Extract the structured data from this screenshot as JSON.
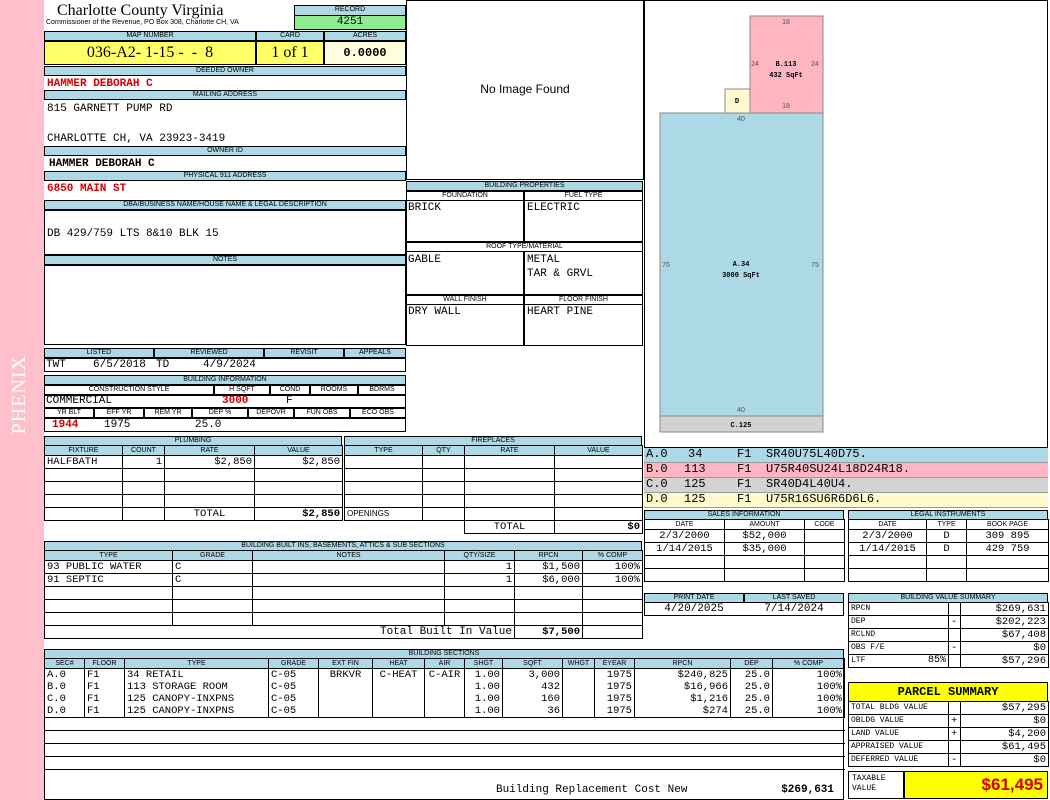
{
  "side_label": "PHENIX",
  "county": {
    "title": "Charlotte County Virginia",
    "subtitle": "Commissioner of the Revenue, PO Box 308, Charlotte CH, VA"
  },
  "record": {
    "label": "RECORD",
    "value": "4251"
  },
  "map_number": {
    "label": "MAP NUMBER",
    "value": "036-A2- 1-15 -  -  8"
  },
  "card": {
    "label": "CARD",
    "value": "1 of 1"
  },
  "acres": {
    "label": "ACRES",
    "value": "0.0000"
  },
  "deeded_owner": {
    "label": "DEEDED OWNER",
    "value": "HAMMER DEBORAH C"
  },
  "mailing_address": {
    "label": "MAILING ADDRESS",
    "line1": "815 GARNETT PUMP RD",
    "line2": "CHARLOTTE CH, VA 23923-3419"
  },
  "owner_id": {
    "label": "OWNER ID",
    "value": "HAMMER DEBORAH C"
  },
  "physical_address": {
    "label": "PHYSICAL 911 ADDRESS",
    "value": "6850 MAIN ST"
  },
  "legal_desc": {
    "label": "DBA/BUSINESS NAME/HOUSE NAME & LEGAL DESCRIPTION",
    "value": "DB 429/759 LTS 8&10 BLK 15"
  },
  "notes": {
    "label": "NOTES"
  },
  "image_placeholder": "No Image Found",
  "building_properties": {
    "label": "BUILDING PROPERTIES",
    "foundation_label": "FOUNDATION",
    "foundation": "BRICK",
    "fuel_label": "FUEL TYPE",
    "fuel": "ELECTRIC",
    "roof_label": "ROOF TYPE/MATERIAL",
    "roof_type": "GABLE",
    "roof_material1": "METAL",
    "roof_material2": "TAR & GRVL",
    "wall_label": "WALL FINISH",
    "wall": "DRY WALL",
    "floor_label": "FLOOR FINISH",
    "floor": "HEART PINE"
  },
  "status": {
    "listed_label": "LISTED",
    "listed_by": "TWT",
    "listed_date": "6/5/2018",
    "reviewed_label": "REVIEWED",
    "reviewed_by": "TD",
    "reviewed_date": "4/9/2024",
    "revisit_label": "REVISIT",
    "appeals_label": "APPEALS"
  },
  "building_info": {
    "label": "BUILDING INFORMATION",
    "style_label": "CONSTRUCTION STYLE",
    "style": "COMMERCIAL",
    "hsqft_label": "H SQFT",
    "hsqft": "3000",
    "cond_label": "COND",
    "cond": "F",
    "rooms_label": "ROOMS",
    "bdrms_label": "BDRMS",
    "yrblt_label": "YR BLT",
    "yrblt": "1944",
    "effyr_label": "EFF YR",
    "effyr": "1975",
    "remyr_label": "REM YR",
    "dep_label": "DEP %",
    "dep": "25.0",
    "depovr_label": "DEPOVR",
    "funobs_label": "FUN OBS",
    "ecoobs_label": "ECO OBS"
  },
  "plumbing": {
    "label": "PLUMBING",
    "headers": [
      "FIXTURE",
      "COUNT",
      "RATE",
      "VALUE"
    ],
    "rows": [
      [
        "HALFBATH",
        "1",
        "$2,850",
        "$2,850"
      ]
    ],
    "total_label": "TOTAL",
    "total": "$2,850"
  },
  "fireplaces": {
    "label": "FIREPLACES",
    "headers": [
      "TYPE",
      "QTY",
      "RATE",
      "VALUE"
    ],
    "openings_label": "OPENINGS",
    "total_label": "TOTAL",
    "total": "$0"
  },
  "built_ins": {
    "label": "BUILDING BUILT INS, BASEMENTS, ATTICS & SUB SECTIONS",
    "headers": [
      "TYPE",
      "GRADE",
      "NOTES",
      "QTY/SIZE",
      "RPCN",
      "% COMP"
    ],
    "rows": [
      [
        "93 PUBLIC WATER",
        "C",
        "",
        "1",
        "$1,500",
        "100%"
      ],
      [
        "91 SEPTIC",
        "C",
        "",
        "1",
        "$6,000",
        "100%"
      ]
    ],
    "total_label": "Total Built In Value",
    "total": "$7,500"
  },
  "sketch": {
    "segments": [
      {
        "code": "A.0",
        "n": "34",
        "floor": "F1",
        "desc": "SR40U75L40D75.",
        "color": "#add8e6"
      },
      {
        "code": "B.0",
        "n": "113",
        "floor": "F1",
        "desc": "U75R40SU24L18D24R18.",
        "color": "#ffb6c1"
      },
      {
        "code": "C.0",
        "n": "125",
        "floor": "F1",
        "desc": "SR40D4L40U4.",
        "color": "#d3d3d3"
      },
      {
        "code": "D.0",
        "n": "125",
        "floor": "F1",
        "desc": "U75R16SU6R6D6L6.",
        "color": "#fffacd"
      }
    ],
    "label_a": "A.34",
    "area_a": "3000 SqFt",
    "label_b": "B.113",
    "area_b": "432 SqFt",
    "label_c": "C.125",
    "label_d": "D",
    "dim_40_top": "40",
    "dim_40_bottom": "40",
    "dim_75_left": "75",
    "dim_75_right": "75",
    "dim_18_top": "18",
    "dim_18_bottom": "18",
    "dim_24_left": "24",
    "dim_24_right": "24"
  },
  "sales": {
    "label": "SALES INFORMATION",
    "headers": [
      "DATE",
      "AMOUNT",
      "CODE"
    ],
    "rows": [
      [
        "2/3/2000",
        "$52,000",
        ""
      ],
      [
        "1/14/2015",
        "$35,000",
        ""
      ]
    ]
  },
  "legal_instruments": {
    "label": "LEGAL INSTRUMENTS",
    "headers": [
      "DATE",
      "TYPE",
      "BOOK PAGE"
    ],
    "rows": [
      [
        "2/3/2000",
        "D",
        "309 895"
      ],
      [
        "1/14/2015",
        "D",
        "429 759"
      ]
    ]
  },
  "print_info": {
    "print_label": "PRINT DATE",
    "print_date": "4/20/2025",
    "saved_label": "LAST SAVED",
    "saved_date": "7/14/2024"
  },
  "value_summary": {
    "label": "BUILDING VALUE SUMMARY",
    "rows": [
      {
        "name": "RPCN",
        "sign": "",
        "value": "$269,631"
      },
      {
        "name": "DEP",
        "sign": "-",
        "value": "$202,223"
      },
      {
        "name": "RCLND",
        "sign": "",
        "value": "$67,408"
      },
      {
        "name": "OBS F/E",
        "sign": "-",
        "value": "$0"
      },
      {
        "name": "LTF",
        "pct": "85%",
        "sign": "",
        "value": "$57,296"
      }
    ]
  },
  "parcel_summary": {
    "label": "PARCEL SUMMARY",
    "rows": [
      {
        "name": "TOTAL BLDG VALUE",
        "sign": "",
        "value": "$57,295"
      },
      {
        "name": "OBLDG VALUE",
        "sign": "+",
        "value": "$0"
      },
      {
        "name": "LAND VALUE",
        "sign": "+",
        "value": "$4,200"
      },
      {
        "name": "APPRAISED VALUE",
        "sign": "",
        "value": "$61,495"
      },
      {
        "name": "DEFERRED VALUE",
        "sign": "-",
        "value": "$0"
      }
    ],
    "taxable_label": "TAXABLE VALUE",
    "taxable": "$61,495"
  },
  "building_sections": {
    "label": "BUILDING SECTIONS",
    "headers": [
      "SEC#",
      "FLOOR",
      "TYPE",
      "GRADE",
      "EXT FIN",
      "HEAT",
      "AIR",
      "SHGT",
      "SQFT",
      "WHGT",
      "EYEAR",
      "RPCN",
      "DEP",
      "% COMP"
    ],
    "rows": [
      [
        "A.0",
        "F1",
        "34 RETAIL",
        "C-05",
        "BRKVR",
        "C-HEAT",
        "C-AIR",
        "1.00",
        "3,000",
        "",
        "1975",
        "$240,825",
        "25.0",
        "100%"
      ],
      [
        "B.0",
        "F1",
        "113 STORAGE ROOM",
        "C-05",
        "",
        "",
        "",
        "1.00",
        "432",
        "",
        "1975",
        "$16,966",
        "25.0",
        "100%"
      ],
      [
        "C.0",
        "F1",
        "125 CANOPY-INXPNS",
        "C-05",
        "",
        "",
        "",
        "1.00",
        "160",
        "",
        "1975",
        "$1,216",
        "25.0",
        "100%"
      ],
      [
        "D.0",
        "F1",
        "125 CANOPY-INXPNS",
        "C-05",
        "",
        "",
        "",
        "1.00",
        "36",
        "",
        "1975",
        "$274",
        "25.0",
        "100%"
      ]
    ],
    "brcn_label": "Building Replacement Cost New",
    "brcn": "$269,631"
  }
}
